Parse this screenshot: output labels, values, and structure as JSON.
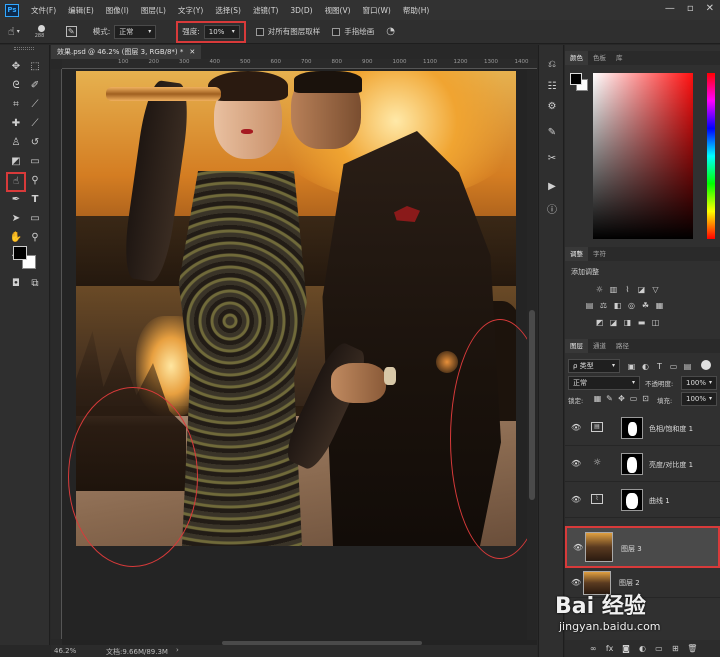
{
  "menubar": {
    "logo": "Ps",
    "items": [
      "文件(F)",
      "编辑(E)",
      "图像(I)",
      "图层(L)",
      "文字(Y)",
      "选择(S)",
      "滤镜(T)",
      "3D(D)",
      "视图(V)",
      "窗口(W)",
      "帮助(H)"
    ],
    "controls": [
      "—",
      "▫",
      "✕"
    ]
  },
  "options": {
    "brush_size": "288",
    "mode_label": "模式:",
    "mode_value": "正常",
    "strength_label": "强度:",
    "strength_value": "10%",
    "sample_all_label": "对所有图层取样",
    "finger_paint_label": "手指绘画"
  },
  "document": {
    "tab_title": "效果.psd @ 46.2% (图层 3, RGB/8*) *",
    "close": "✕",
    "ruler_ticks": [
      "100",
      "200",
      "300",
      "400",
      "500",
      "600",
      "700",
      "800",
      "900",
      "1000",
      "1100",
      "1200",
      "1300",
      "1400",
      "150"
    ],
    "zoom": "46.2%",
    "doc_size": "文档:9.66M/89.3M",
    "nav_arrow": "›"
  },
  "color_panel": {
    "tabs": [
      "颜色",
      "色板",
      "库"
    ]
  },
  "adjustments_panel": {
    "tabs": [
      "调整",
      "字符"
    ],
    "add_label": "添加调整"
  },
  "layers_panel": {
    "tabs": [
      "图层",
      "通道",
      "路径"
    ],
    "filter_label": "ρ 类型",
    "blend_mode": "正常",
    "opacity_label": "不透明度:",
    "opacity_value": "100%",
    "lock_label": "锁定:",
    "fill_label": "填充:",
    "fill_value": "100%",
    "layers": [
      {
        "name": "色相/饱和度 1",
        "selected": false
      },
      {
        "name": "亮度/对比度 1",
        "selected": false
      },
      {
        "name": "曲线 1",
        "selected": false
      },
      {
        "name": "图层 3",
        "selected": true
      },
      {
        "name": "图层 2",
        "selected": false
      }
    ]
  },
  "watermark": {
    "logo": "Bai 经验",
    "url": "jingyan.baidu.com"
  },
  "colors": {
    "highlight": "#d83a3a",
    "panel_bg": "#303030",
    "menu_bg": "#323232",
    "selected_layer": "#4a4a4a"
  }
}
